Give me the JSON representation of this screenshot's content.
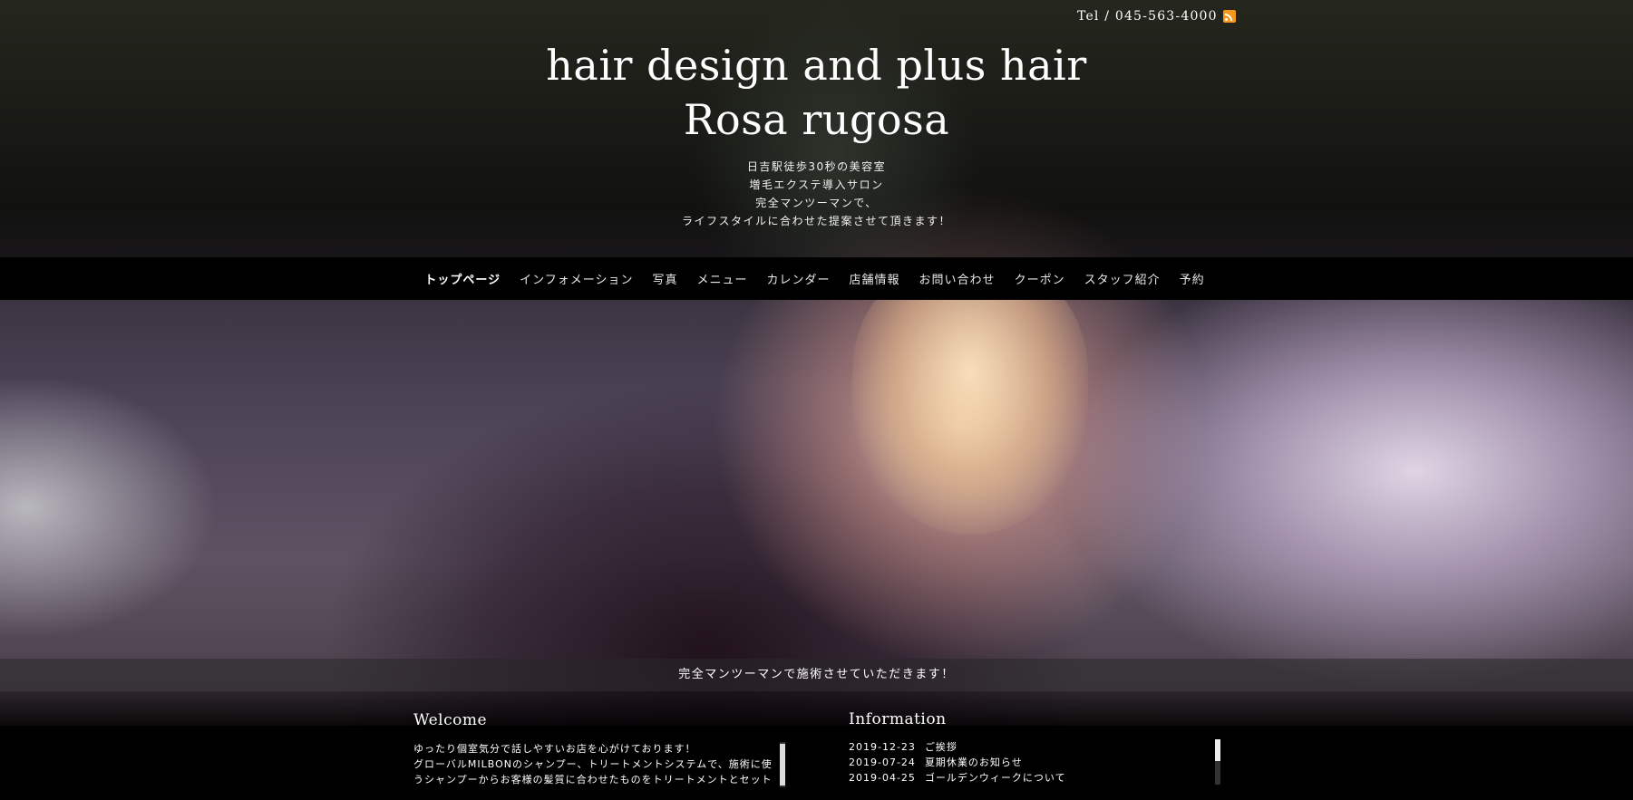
{
  "header": {
    "tel": "Tel / 045-563-4000",
    "rss_icon": "rss-icon",
    "title_line1": "hair design and plus hair",
    "title_line2": "Rosa rugosa",
    "tagline": [
      "日吉駅徒歩30秒の美容室",
      "増毛エクステ導入サロン",
      "完全マンツーマンで、",
      "ライフスタイルに合わせた提案させて頂きます！"
    ]
  },
  "nav": {
    "items": [
      {
        "label": "トップページ",
        "active": true
      },
      {
        "label": "インフォメーション"
      },
      {
        "label": "写真"
      },
      {
        "label": "メニュー"
      },
      {
        "label": "カレンダー"
      },
      {
        "label": "店舗情報"
      },
      {
        "label": "お問い合わせ"
      },
      {
        "label": "クーポン"
      },
      {
        "label": "スタッフ紹介"
      },
      {
        "label": "予約"
      }
    ]
  },
  "hero": {
    "caption": "完全マンツーマンで施術させていただきます！"
  },
  "welcome": {
    "title": "Welcome",
    "lines": [
      "ゆったり個室気分で話しやすいお店を心がけております！",
      "グローバルMILBONのシャンプー、トリートメントシステムで、施術に使",
      "うシャンプーからお客様の髪質に合わせたものをトリートメントとセット"
    ]
  },
  "information": {
    "title": "Information",
    "items": [
      {
        "date": "2019-12-23",
        "title": "ご挨拶"
      },
      {
        "date": "2019-07-24",
        "title": "夏期休業のお知らせ"
      },
      {
        "date": "2019-04-25",
        "title": "ゴールデンウィークについて"
      }
    ]
  }
}
